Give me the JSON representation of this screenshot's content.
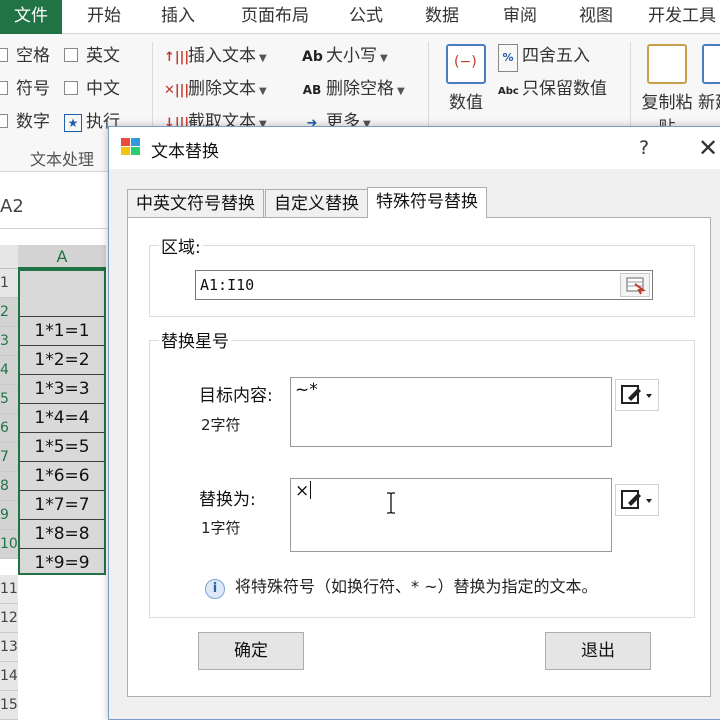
{
  "ribbon_tabs": [
    "文件",
    "开始",
    "插入",
    "页面布局",
    "公式",
    "数据",
    "审阅",
    "视图",
    "开发工具"
  ],
  "ribbon": {
    "checkboxes": [
      "空格",
      "符号",
      "数字",
      "英文",
      "中文"
    ],
    "execute_label": "执行",
    "insert_text": "插入文本",
    "delete_text": "删除文本",
    "extract_text": "截取文本",
    "case_label": "大小写",
    "delete_spaces": "删除空格",
    "more_label": "更多",
    "round_label": "四舍五入",
    "keep_values": "只保留数值",
    "value_label": "数值",
    "copy_paste": "复制粘贴",
    "new_label": "新建",
    "group_label": "文本处理",
    "case_icon": "Ab",
    "round_icon": "%",
    "keep_icon": "Abc",
    "delete_spaces_icon": "AB"
  },
  "name_box": "A2",
  "sheet": {
    "column_a": "A",
    "row_numbers": [
      "1",
      "2",
      "3",
      "4",
      "5",
      "6",
      "7",
      "8",
      "9",
      "10",
      "11",
      "12",
      "13",
      "14",
      "15"
    ],
    "cells": [
      "",
      "1*1=1",
      "1*2=2",
      "1*3=3",
      "1*4=4",
      "1*5=5",
      "1*6=6",
      "1*7=7",
      "1*8=8",
      "1*9=9"
    ]
  },
  "dialog": {
    "title": "文本替换",
    "help": "?",
    "close": "✕",
    "tabs": [
      "中英文符号替换",
      "自定义替换",
      "特殊符号替换"
    ],
    "active_tab": 2,
    "range_group": "区域:",
    "range_value": "A1:I10",
    "replace_group": "替换星号",
    "target_label": "目标内容:",
    "target_count": "2字符",
    "target_value": "~*",
    "replace_label": "替换为:",
    "replace_count": "1字符",
    "replace_value": "×",
    "info_text": "将特殊符号（如换行符、* ~）替换为指定的文本。",
    "ok_button": "确定",
    "exit_button": "退出"
  },
  "colors": {
    "excel_green": "#217346",
    "dialog_border": "#7a9cc6"
  }
}
